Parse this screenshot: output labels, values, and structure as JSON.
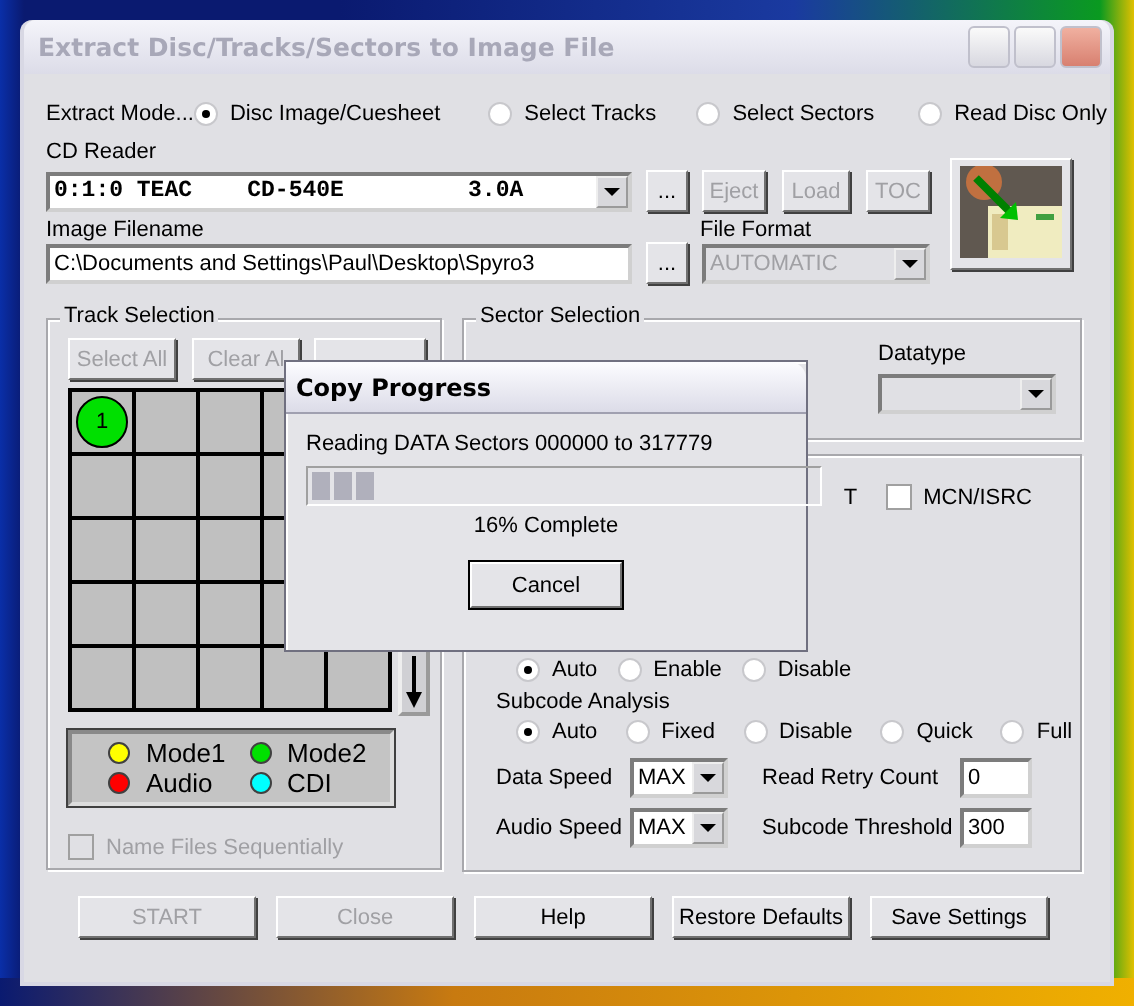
{
  "window": {
    "title": "Extract Disc/Tracks/Sectors to Image File"
  },
  "extract_mode": {
    "label": "Extract Mode...",
    "options": [
      {
        "label": "Disc Image/Cuesheet",
        "selected": true
      },
      {
        "label": "Select Tracks",
        "selected": false
      },
      {
        "label": "Select Sectors",
        "selected": false
      },
      {
        "label": "Read Disc Only",
        "selected": false
      }
    ]
  },
  "cd_reader": {
    "label": "CD Reader",
    "value": "0:1:0 TEAC    CD-540E         3.0A",
    "browse": "...",
    "buttons": [
      {
        "label": "Eject",
        "disabled": true
      },
      {
        "label": "Load",
        "disabled": true
      },
      {
        "label": "TOC",
        "disabled": true
      }
    ]
  },
  "image_filename": {
    "label": "Image Filename",
    "value": "C:\\Documents and Settings\\Paul\\Desktop\\Spyro3",
    "browse": "..."
  },
  "file_format": {
    "label": "File Format",
    "value": "AUTOMATIC",
    "disabled": true
  },
  "track_selection": {
    "title": "Track Selection",
    "buttons": [
      {
        "label": "Select All",
        "disabled": true
      },
      {
        "label": "Clear Al",
        "disabled": true
      }
    ],
    "tracks": [
      {
        "label": "1",
        "color": "#00e000"
      }
    ],
    "legend": [
      {
        "label": "Mode1",
        "color": "#ffff00"
      },
      {
        "label": "Mode2",
        "color": "#00e000"
      },
      {
        "label": "Audio",
        "color": "#ff0000"
      },
      {
        "label": "CDI",
        "color": "#00ffff"
      }
    ],
    "name_files": {
      "label": "Name Files Sequentially",
      "checked": false,
      "disabled": true
    }
  },
  "sector_selection": {
    "title": "Sector Selection",
    "datatype": {
      "label": "Datatype",
      "disabled": true
    }
  },
  "options": {
    "fragment": "T",
    "mcn_isrc": {
      "label": "MCN/ISRC",
      "checked": false
    },
    "mode_radios": [
      {
        "label": "Auto",
        "selected": true
      },
      {
        "label": "Enable",
        "selected": false
      },
      {
        "label": "Disable",
        "selected": false
      }
    ],
    "subcode_analysis": {
      "label": "Subcode Analysis",
      "options": [
        {
          "label": "Auto",
          "selected": true
        },
        {
          "label": "Fixed",
          "selected": false
        },
        {
          "label": "Disable",
          "selected": false
        },
        {
          "label": "Quick",
          "selected": false
        },
        {
          "label": "Full",
          "selected": false
        }
      ]
    },
    "data_speed": {
      "label": "Data Speed",
      "value": "MAX"
    },
    "audio_speed": {
      "label": "Audio Speed",
      "value": "MAX"
    },
    "read_retry_count": {
      "label": "Read Retry Count",
      "value": "0"
    },
    "subcode_threshold": {
      "label": "Subcode Threshold",
      "value": "300"
    }
  },
  "buttons": [
    {
      "label": "START",
      "disabled": true
    },
    {
      "label": "Close",
      "disabled": true
    },
    {
      "label": "Help",
      "disabled": false
    },
    {
      "label": "Restore Defaults",
      "disabled": false
    },
    {
      "label": "Save Settings",
      "disabled": false
    }
  ],
  "progress_dialog": {
    "title": "Copy Progress",
    "message": "Reading DATA Sectors 000000 to 317779",
    "level": 0.16,
    "percent": "16% Complete",
    "cancel": "Cancel"
  }
}
